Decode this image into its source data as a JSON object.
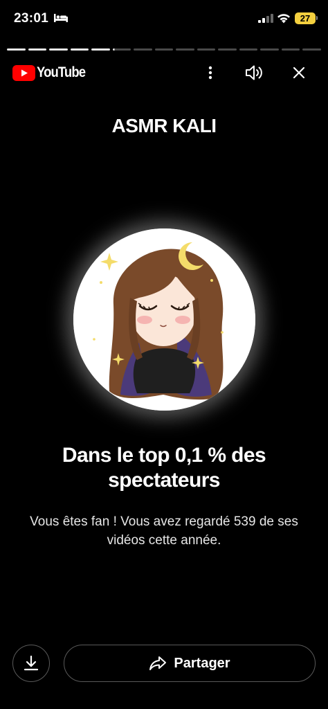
{
  "status_bar": {
    "time": "23:01",
    "battery_level": "27",
    "icons": [
      "bed-icon",
      "cellular-signal-icon",
      "wifi-icon",
      "battery-icon"
    ]
  },
  "story_progress": {
    "segments": 15,
    "completed": 5,
    "current_fraction": 0.1
  },
  "app_bar": {
    "logo_text": "YouTube",
    "brand_color": "#ff0000",
    "icons": [
      "more-vertical-icon",
      "speaker-icon",
      "close-icon"
    ]
  },
  "slide": {
    "channel_name": "ASMR KALI",
    "headline": "Dans le top 0,1 % des spectateurs",
    "description": "Vous êtes fan ! Vous avez regardé 539 de ses vidéos cette année."
  },
  "actions": {
    "download_icon": "download-icon",
    "share_label": "Partager",
    "share_icon": "share-arrow-icon"
  }
}
